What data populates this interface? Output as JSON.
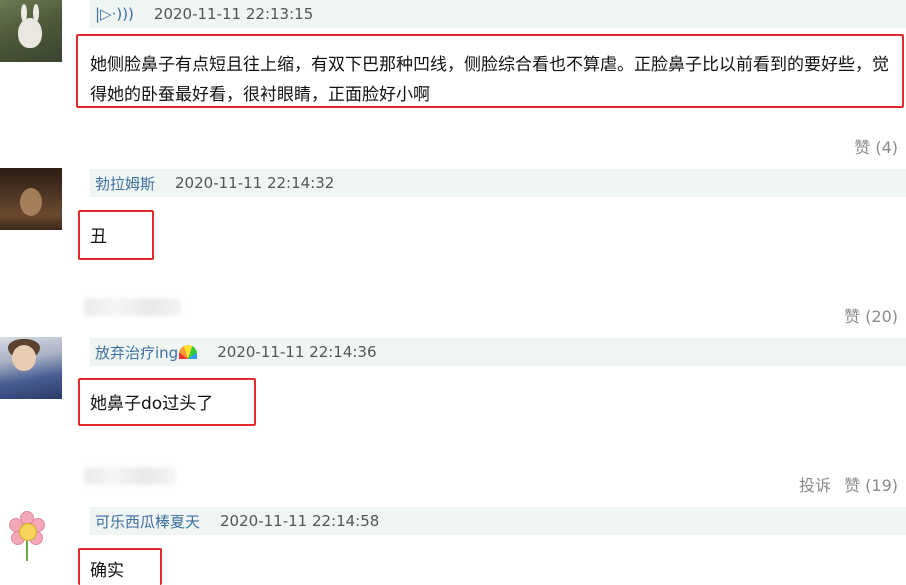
{
  "comments": [
    {
      "username": "|▷·)))",
      "time": "2020-11-11 22:13:15",
      "text": "她侧脸鼻子有点短且往上缩，有双下巴那种凹线，侧脸综合看也不算虐。正脸鼻子比以前看到的要好些，觉得她的卧蚕最好看，很衬眼睛，正面脸好小啊",
      "likes": "赞 (4)"
    },
    {
      "username": "勃拉姆斯",
      "time": "2020-11-11 22:14:32",
      "text": "丑",
      "likes": "赞 (20)"
    },
    {
      "username": "放弃治疗ing",
      "time": "2020-11-11 22:14:36",
      "text": "她鼻子do过头了",
      "report": "投诉",
      "likes": "赞 (19)"
    },
    {
      "username": "可乐西瓜棒夏天",
      "time": "2020-11-11 22:14:58",
      "text": "确实"
    }
  ],
  "colors": {
    "header_bg": "#eef5f3",
    "username": "#3f6f9f",
    "highlight_border": "#e32a2a",
    "muted": "#8a8a8a"
  }
}
